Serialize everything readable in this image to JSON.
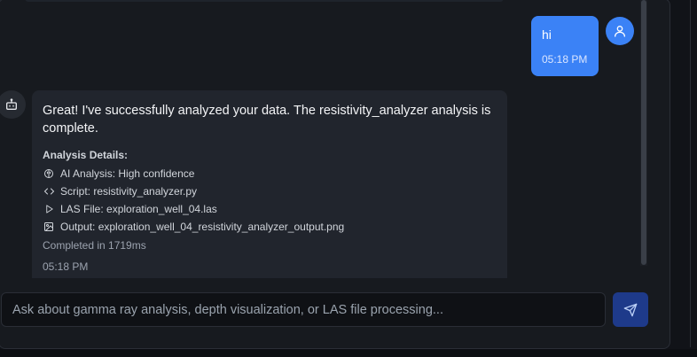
{
  "conversation": {
    "user_message": {
      "text": "hi",
      "time": "05:18 PM"
    },
    "bot_message": {
      "text": "Great! I've successfully analyzed your data. The resistivity_analyzer analysis is complete.",
      "details_title": "Analysis Details:",
      "details": [
        {
          "icon": "brain-icon",
          "label": "AI Analysis: High confidence"
        },
        {
          "icon": "code-icon",
          "label": "Script: resistivity_analyzer.py"
        },
        {
          "icon": "play-icon",
          "label": "LAS File: exploration_well_04.las"
        },
        {
          "icon": "image-icon",
          "label": "Output: exploration_well_04_resistivity_analyzer_output.png"
        }
      ],
      "completed": "Completed in 1719ms",
      "time": "05:18 PM"
    }
  },
  "input": {
    "placeholder": "Ask about gamma ray analysis, depth visualization, or LAS file processing..."
  },
  "colors": {
    "accent": "#3b82f6",
    "send_button": "#1e3a8a",
    "panel": "#171a1f",
    "bubble": "#21252d"
  }
}
